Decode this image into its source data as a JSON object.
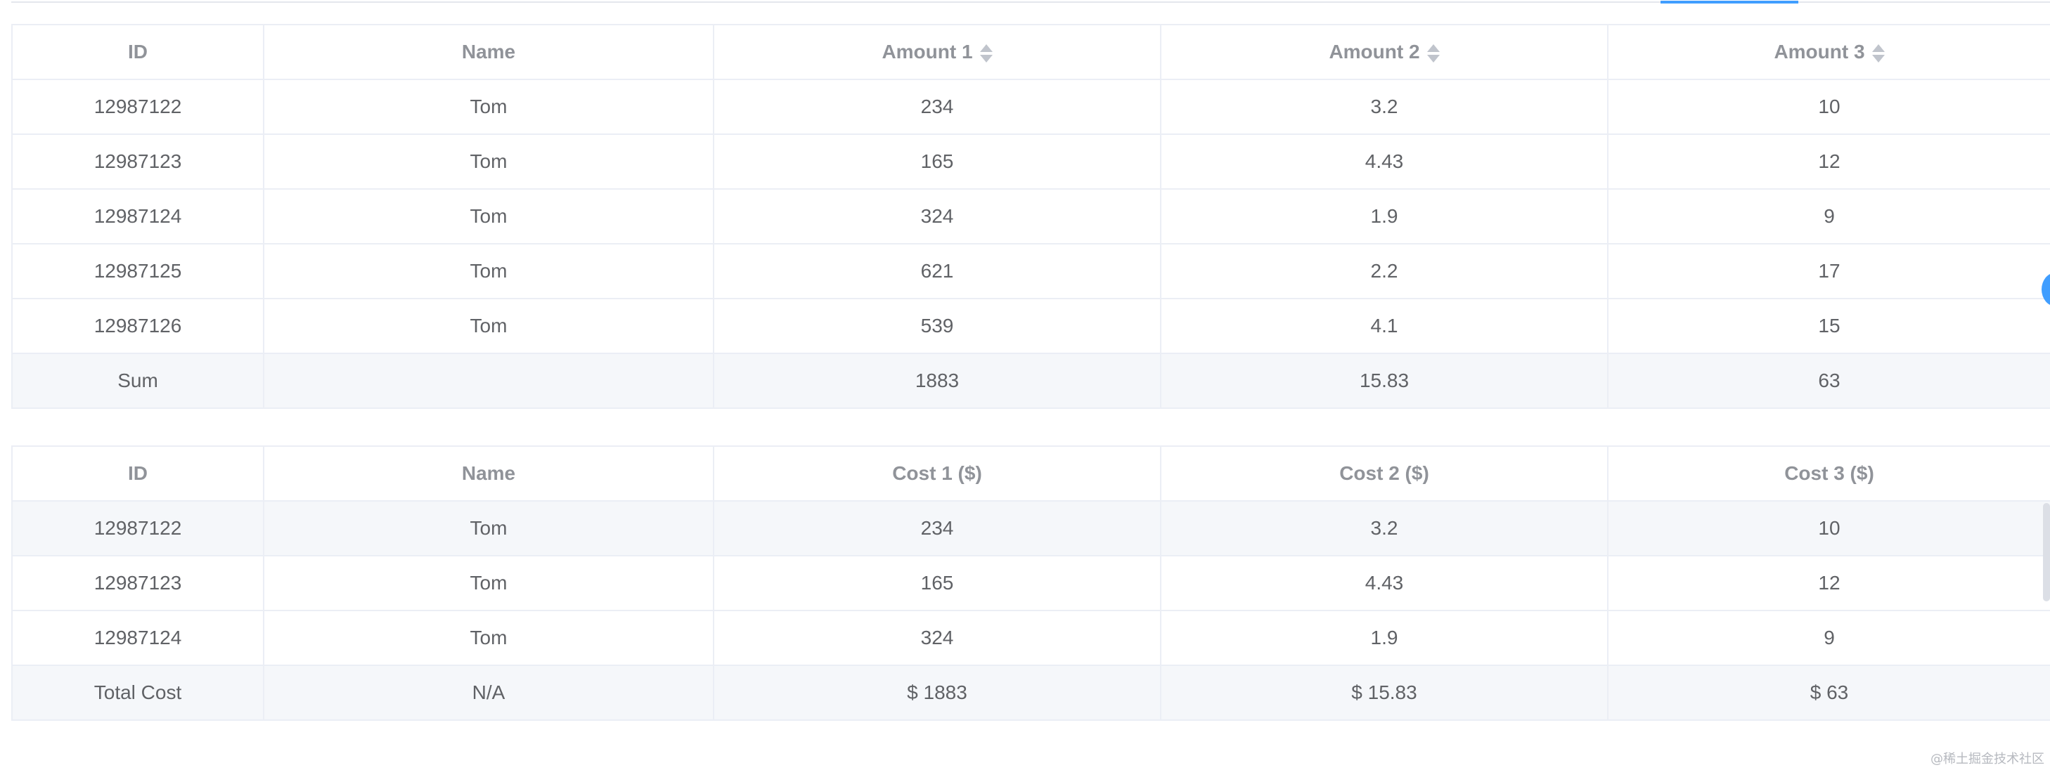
{
  "table_amount": {
    "headers": [
      "ID",
      "Name",
      "Amount 1",
      "Amount 2",
      "Amount 3"
    ],
    "rows": [
      [
        "12987122",
        "Tom",
        "234",
        "3.2",
        "10"
      ],
      [
        "12987123",
        "Tom",
        "165",
        "4.43",
        "12"
      ],
      [
        "12987124",
        "Tom",
        "324",
        "1.9",
        "9"
      ],
      [
        "12987125",
        "Tom",
        "621",
        "2.2",
        "17"
      ],
      [
        "12987126",
        "Tom",
        "539",
        "4.1",
        "15"
      ]
    ],
    "summary": [
      "Sum",
      "",
      "1883",
      "15.83",
      "63"
    ]
  },
  "table_cost": {
    "headers": [
      "ID",
      "Name",
      "Cost 1 ($)",
      "Cost 2 ($)",
      "Cost 3 ($)"
    ],
    "rows": [
      [
        "12987122",
        "Tom",
        "234",
        "3.2",
        "10"
      ],
      [
        "12987123",
        "Tom",
        "165",
        "4.43",
        "12"
      ],
      [
        "12987124",
        "Tom",
        "324",
        "1.9",
        "9"
      ]
    ],
    "summary": [
      "Total Cost",
      "N/A",
      "$ 1883",
      "$ 15.83",
      "$ 63"
    ]
  },
  "icons": {
    "sort": "sort-caret-icon"
  },
  "watermark": "@稀土掘金技术社区",
  "colors": {
    "accent": "#409eff",
    "header_text": "#909399",
    "body_text": "#606266",
    "border": "#ebeef5",
    "sum_bg": "#f5f7fa"
  }
}
